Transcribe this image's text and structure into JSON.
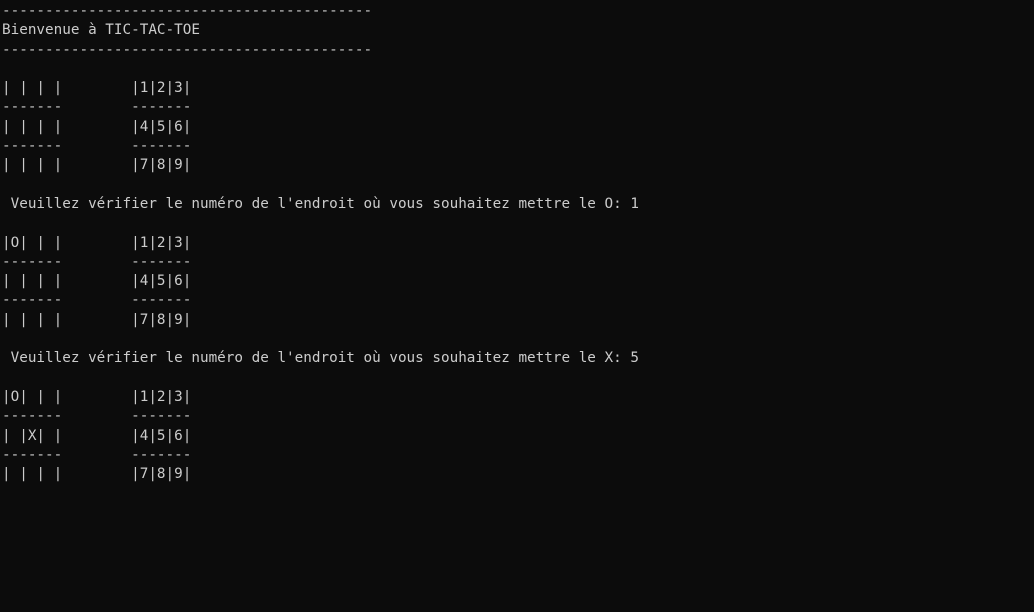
{
  "console": {
    "lines": [
      "-------------------------------------------",
      "Bienvenue à TIC-TAC-TOE",
      "-------------------------------------------",
      "",
      "| | | |        |1|2|3|",
      "-------        -------",
      "| | | |        |4|5|6|",
      "-------        -------",
      "| | | |        |7|8|9|",
      "",
      " Veuillez vérifier le numéro de l'endroit où vous souhaitez mettre le O: 1",
      "",
      "|O| | |        |1|2|3|",
      "-------        -------",
      "| | | |        |4|5|6|",
      "-------        -------",
      "| | | |        |7|8|9|",
      "",
      " Veuillez vérifier le numéro de l'endroit où vous souhaitez mettre le X: 5",
      "",
      "|O| | |        |1|2|3|",
      "-------        -------",
      "| |X| |        |4|5|6|",
      "-------        -------",
      "| | | |        |7|8|9|"
    ]
  }
}
